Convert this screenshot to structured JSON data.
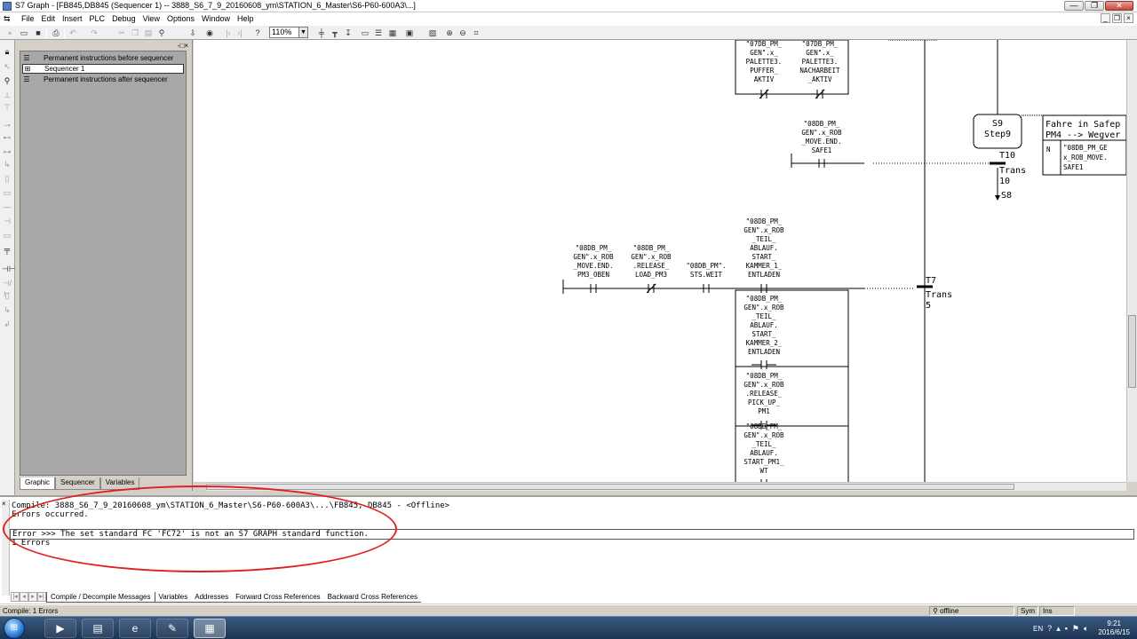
{
  "window": {
    "title": "S7 Graph - [FB845,DB845 (Sequencer 1) -- 3888_S6_7_9_20160608_ym\\STATION_6_Master\\S6-P60-600A3\\...]",
    "minimize": "—",
    "restore": "❐",
    "close": "✕"
  },
  "menu": {
    "items": [
      "File",
      "Edit",
      "Insert",
      "PLC",
      "Debug",
      "View",
      "Options",
      "Window",
      "Help"
    ]
  },
  "toolbar": {
    "zoom": "110%"
  },
  "overview": {
    "items": [
      {
        "label": "Permanent instructions before sequencer",
        "icon": "list-icon"
      },
      {
        "label": "Sequencer 1",
        "icon": "sequencer-icon"
      },
      {
        "label": "Permanent instructions after sequencer",
        "icon": "list-icon"
      }
    ],
    "tabs": [
      "Graphic",
      "Sequencer",
      "Variables"
    ],
    "active_tab": "Graphic"
  },
  "graph": {
    "top_contacts": [
      {
        "label": "\"07DB_PM_ GEN\".x_ PALETTE3. PUFFER_ AKTIV",
        "lines": [
          "\"07DB_PM_",
          "GEN\".x_",
          "PALETTE3.",
          "PUFFER_",
          "AKTIV"
        ],
        "kind": "NC"
      },
      {
        "label": "\"07DB_PM_ GEN\".x_ PALETTE3. NACHARBEIT _AKTIV",
        "lines": [
          "\"07DB_PM_",
          "GEN\".x_",
          "PALETTE3.",
          "NACHARBEIT",
          "_AKTIV"
        ],
        "kind": "NC"
      }
    ],
    "t10_contact": {
      "label": "\"08DB_PM_ GEN\".x_ROB _MOVE.END. SAFE1",
      "lines": [
        "\"08DB_PM_",
        "GEN\".x_ROB",
        "_MOVE.END.",
        "SAFE1"
      ],
      "kind": "NO"
    },
    "t7_contacts": [
      {
        "label": "\"08DB_PM_ GEN\".x_ROB _MOVE.END. PM3_OBEN",
        "lines": [
          "\"08DB_PM_",
          "GEN\".x_ROB",
          "_MOVE.END.",
          "PM3_OBEN"
        ],
        "kind": "NO"
      },
      {
        "label": "\"08DB_PM_ GEN\".x_ROB .RELEASE_ LOAD_PM3",
        "lines": [
          "\"08DB_PM_",
          "GEN\".x_ROB",
          ".RELEASE_",
          "LOAD_PM3"
        ],
        "kind": "NC"
      },
      {
        "label": "\"08DB_PM\". STS.WEIT",
        "lines": [
          "\"08DB_PM\".",
          "STS.WEIT"
        ],
        "kind": "NO"
      }
    ],
    "t7_parallel": [
      {
        "label": "\"08DB_PM_ GEN\".x_ROB _TEIL_ ABLAUF. START_ KAMMER_1_ ENTLADEN",
        "lines": [
          "\"08DB_PM_",
          "GEN\".x_ROB",
          "_TEIL_",
          "ABLAUF.",
          "START_",
          "KAMMER_1_",
          "ENTLADEN"
        ],
        "kind": "NO"
      },
      {
        "label": "\"08DB_PM_ GEN\".x_ROB _TEIL_ ABLAUF. START_ KAMMER_2_ ENTLADEN",
        "lines": [
          "\"08DB_PM_",
          "GEN\".x_ROB",
          "_TEIL_",
          "ABLAUF.",
          "START_",
          "KAMMER_2_",
          "ENTLADEN"
        ],
        "kind": "NO"
      },
      {
        "label": "\"08DB_PM_ GEN\".x_ROB .RELEASE_ PICK_UP_ PM1",
        "lines": [
          "\"08DB_PM_",
          "GEN\".x_ROB",
          ".RELEASE_",
          "PICK_UP_",
          "PM1"
        ],
        "kind": "NO"
      },
      {
        "label": "\"08DB_PM_ GEN\".x_ROB _TEIL_ ABLAUF. START_PM1_ WT",
        "lines": [
          "\"08DB_PM_",
          "GEN\".x_ROB",
          "_TEIL_",
          "ABLAUF.",
          "START_PM1_",
          "WT"
        ],
        "kind": "NO"
      }
    ],
    "step": {
      "number": "S9",
      "name": "Step9"
    },
    "t10": {
      "number": "T10",
      "name": "Trans",
      "index": "10",
      "jump": "S8"
    },
    "t7": {
      "number": "T7",
      "name": "Trans",
      "index": "5"
    },
    "action": {
      "header_lines": [
        "Fahre in Safep",
        "PM4 --> Wegver"
      ],
      "qualifier": "N",
      "operand_lines": [
        "\"08DB_PM_GE",
        "x_ROB_MOVE.",
        "SAFE1"
      ]
    }
  },
  "details": {
    "lines": [
      "Compile: 3888_S6_7_9_20160608_ym\\STATION_6_Master\\S6-P60-600A3\\...\\FB845, DB845 - <Offline>",
      "Errors occurred.",
      "",
      "Error >>> The set standard FC 'FC72' is not an S7 GRAPH standard function.",
      "1 Errors"
    ],
    "tabs": [
      "Compile / Decompile Messages",
      "Variables",
      "Addresses",
      "Forward Cross References",
      "Backward Cross References"
    ],
    "active_tab": "Compile / Decompile Messages"
  },
  "status": {
    "left": "Compile: 1 Errors",
    "mode": "offline",
    "sym": "Sym",
    "ins": "Ins"
  },
  "taskbar": {
    "lang": "EN",
    "time": "9:21",
    "date": "2016/6/15"
  },
  "colors": {
    "annotation": "#e02020",
    "canvas": "#ffffff",
    "chrome": "#d4d0c8"
  }
}
